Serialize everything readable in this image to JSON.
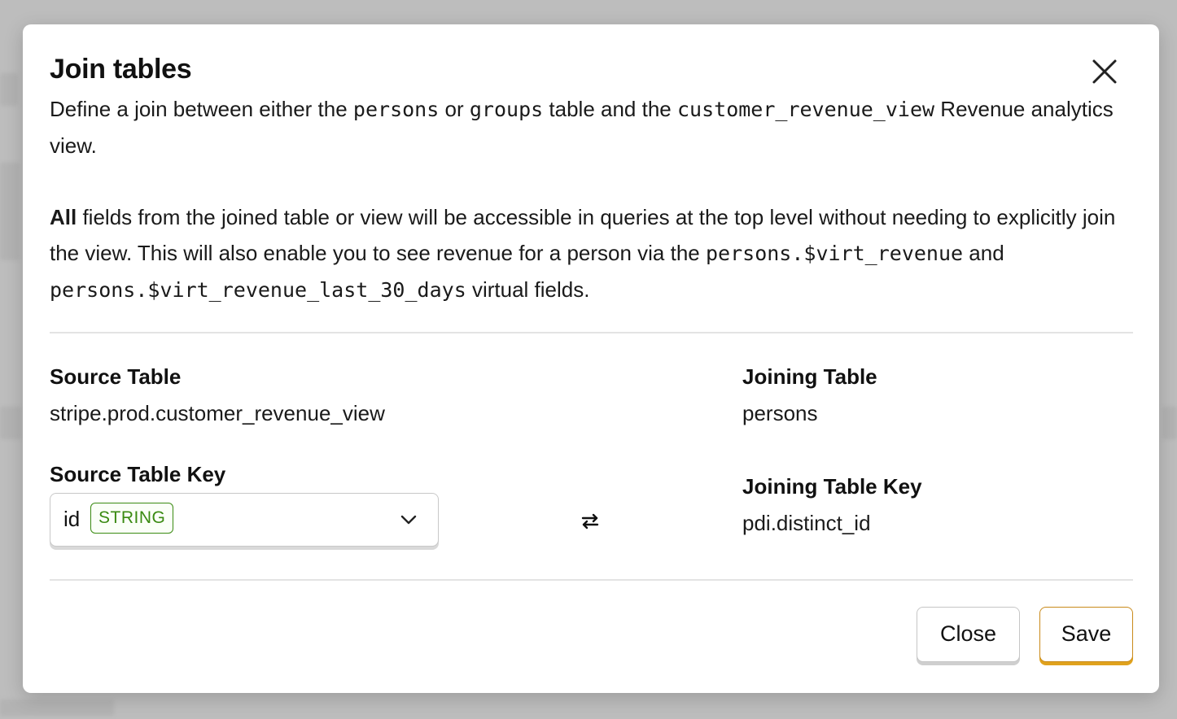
{
  "dialog": {
    "title": "Join tables",
    "intro": {
      "t1": "Define a join between either the ",
      "code_persons": "persons",
      "t2": " or ",
      "code_groups": "groups",
      "t3": " table and the ",
      "code_view": "customer_revenue_view",
      "t4": " Revenue analytics view."
    },
    "details": {
      "bold_all": "All",
      "t1": " fields from the joined table or view will be accessible in queries at the top level without needing to explicitly join the view. This will also enable you to see revenue for a person via the ",
      "code_revenue": "persons.$virt_revenue",
      "t2": " and ",
      "code_revenue_30": "persons.$virt_revenue_last_30_days",
      "t3": " virtual fields."
    },
    "source_table_label": "Source Table",
    "source_table_value": "stripe.prod.customer_revenue_view",
    "joining_table_label": "Joining Table",
    "joining_table_value": "persons",
    "source_key_label": "Source Table Key",
    "source_key_select": {
      "value": "id",
      "type_badge": "STRING"
    },
    "joining_key_label": "Joining Table Key",
    "joining_key_value": "pdi.distinct_id",
    "close_button": "Close",
    "save_button": "Save"
  },
  "icons": {
    "close": "close-icon",
    "chevron": "chevron-down-icon",
    "swap": "swap-arrows-icon"
  },
  "colors": {
    "badge_green": "#3a8a12",
    "save_accent": "#e0a21d"
  }
}
